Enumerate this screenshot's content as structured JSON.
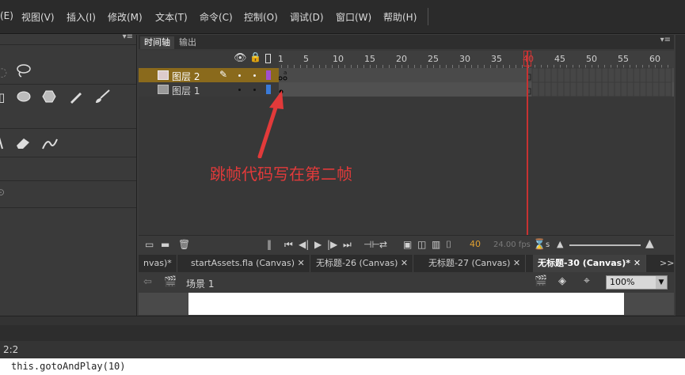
{
  "menu": {
    "items": [
      "(E)",
      "视图(V)",
      "插入(I)",
      "修改(M)",
      "文本(T)",
      "命令(C)",
      "控制(O)",
      "调试(D)",
      "窗口(W)",
      "帮助(H)"
    ]
  },
  "timeline": {
    "tabs": [
      "时间轴",
      "输出"
    ],
    "ruler_labels": [
      "1",
      "5",
      "10",
      "15",
      "20",
      "25",
      "30",
      "35",
      "40",
      "45",
      "50",
      "55",
      "60"
    ],
    "layers": [
      {
        "name": "图层 2",
        "selected": true,
        "color": "#a050d0"
      },
      {
        "name": "图层 1",
        "selected": false,
        "color": "#3a7ad8"
      }
    ],
    "current_frame": "40",
    "fps": "24.00 fps",
    "elapsed": "s"
  },
  "annotation": "跳帧代码写在第二帧",
  "documents": {
    "tabs": [
      "nvas)*",
      "startAssets.fla (Canvas)",
      "无标题-26 (Canvas)",
      "无标题-27 (Canvas)",
      "无标题-30 (Canvas)*"
    ],
    "overflow": ">>"
  },
  "scene": {
    "name": "场景 1",
    "zoom": "100%"
  },
  "status": {
    "position": "2:2"
  },
  "code": "this.gotoAndPlay(10)",
  "colors": {
    "selected_layer": "#8a6a1c",
    "playhead": "#c83232",
    "annotation": "#e23a3a"
  }
}
